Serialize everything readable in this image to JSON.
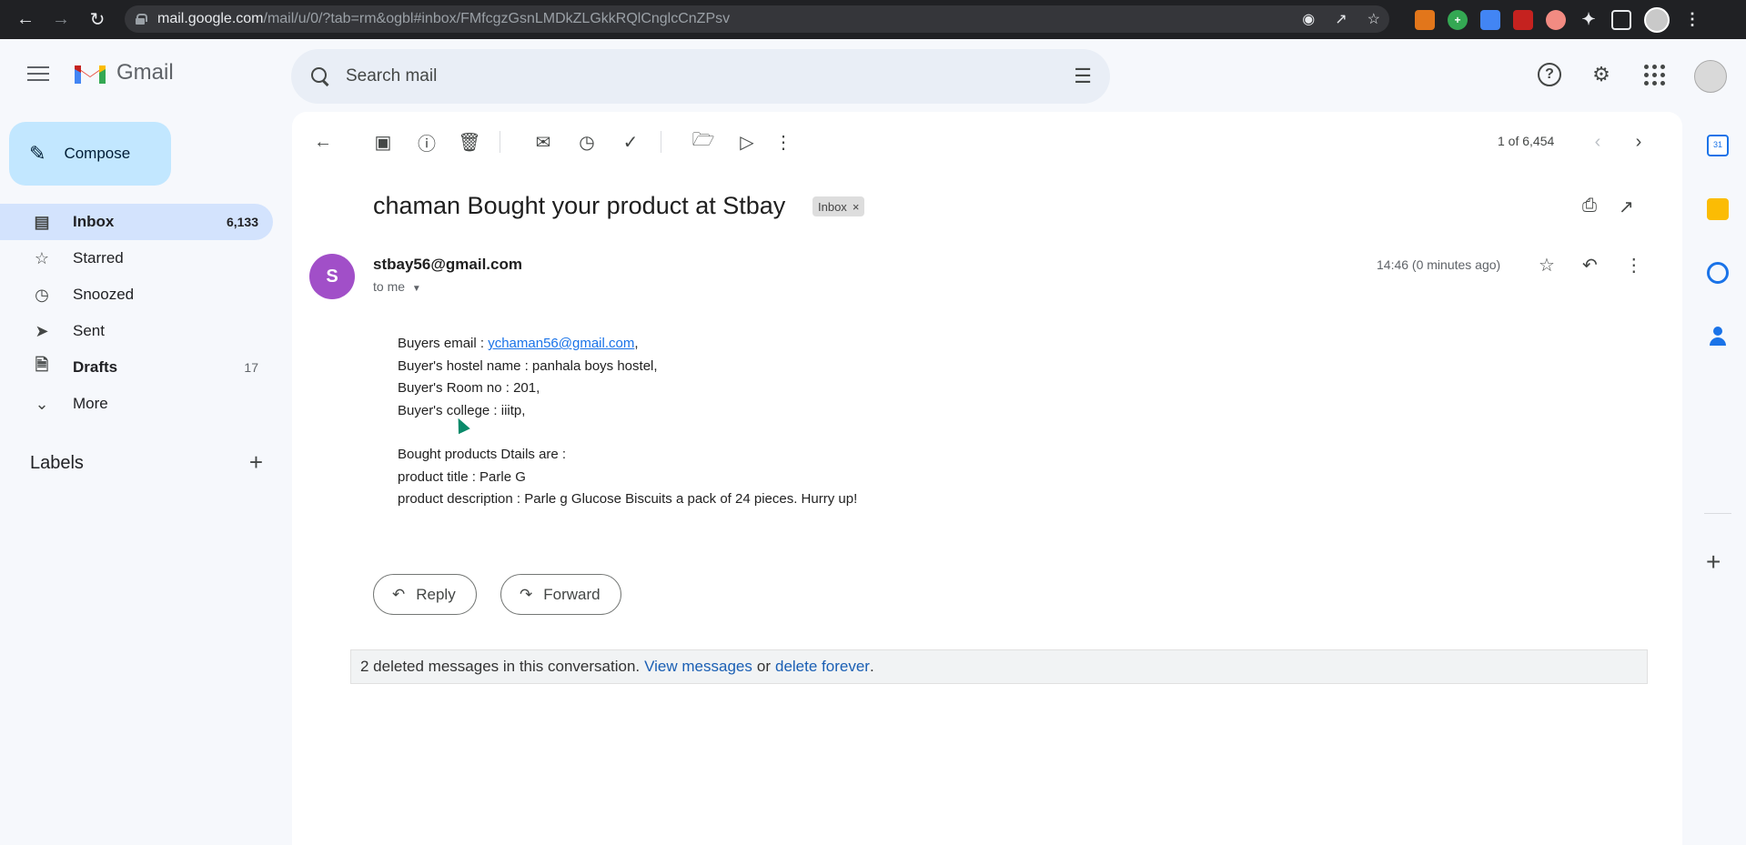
{
  "browser": {
    "url_host": "mail.google.com",
    "url_path": "/mail/u/0/?tab=rm&ogbl#inbox/FMfcgzGsnLMDkZLGkkRQlCnglcCnZPsv"
  },
  "app": {
    "name": "Gmail",
    "search_placeholder": "Search mail"
  },
  "sidebar": {
    "compose_label": "Compose",
    "items": [
      {
        "label": "Inbox",
        "count": "6,133",
        "icon": "inbox-icon"
      },
      {
        "label": "Starred",
        "count": "",
        "icon": "star-icon"
      },
      {
        "label": "Snoozed",
        "count": "",
        "icon": "clock-icon"
      },
      {
        "label": "Sent",
        "count": "",
        "icon": "send-icon"
      },
      {
        "label": "Drafts",
        "count": "17",
        "icon": "draft-icon"
      },
      {
        "label": "More",
        "count": "",
        "icon": "chevron-down-icon"
      }
    ],
    "labels_heading": "Labels"
  },
  "toolbar": {
    "pager": "1 of 6,454"
  },
  "email": {
    "subject": "chaman Bought your product at Stbay",
    "chip": "Inbox",
    "sender": "stbay56@gmail.com",
    "to": "to me",
    "timestamp": "14:46 (0 minutes ago)",
    "avatar_letter": "S",
    "avatar_color": "#a14fc8",
    "body": {
      "line1_prefix": "Buyers email : ",
      "line1_link": "ychaman56@gmail.com",
      "line1_suffix": ",",
      "line2": "Buyer's hostel name : panhala boys hostel,",
      "line3": "Buyer's Room no :  201,",
      "line4": "Buyer's college :  iiitp,",
      "line5": "Bought products Dtails are  :",
      "line6": "product title : Parle G",
      "line7": "product description : Parle g Glucose Biscuits a pack of 24 pieces. Hurry up!"
    },
    "reply_label": "Reply",
    "forward_label": "Forward",
    "deleted_text": "2 deleted messages in this conversation.",
    "view_messages": "View messages",
    "or_text": "or",
    "delete_forever": "delete forever",
    "period": "."
  },
  "colors": {
    "compose_bg": "#c2e7ff",
    "active_nav_bg": "#d3e3fd",
    "link": "#1a73e8"
  }
}
